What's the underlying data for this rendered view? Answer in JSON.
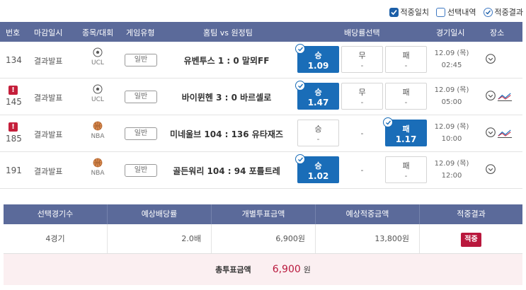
{
  "legend": [
    {
      "label": "적중일치",
      "state": "checked"
    },
    {
      "label": "선택내역",
      "state": "empty"
    },
    {
      "label": "적중결과",
      "state": "circle"
    }
  ],
  "columns": [
    "번호",
    "마감일시",
    "종목/대회",
    "게임유형",
    "홈팀 vs 원정팀",
    "배당률선택",
    "경기일시",
    "장소"
  ],
  "rows": [
    {
      "no": "134",
      "alert": false,
      "status": "결과발표",
      "sport_icon": "soccer-ball-icon",
      "league": "UCL",
      "type": "일반",
      "match": "유벤투스 1 : 0 말뫼FF",
      "odds": [
        {
          "label": "승",
          "value": "1.09",
          "selected": true
        },
        {
          "label": "무",
          "value": "-",
          "selected": false
        },
        {
          "label": "패",
          "value": "-",
          "selected": false
        }
      ],
      "date": "12.09 (목)",
      "time": "02:45",
      "chart": false
    },
    {
      "no": "145",
      "alert": true,
      "status": "결과발표",
      "sport_icon": "soccer-ball-icon",
      "league": "UCL",
      "type": "일반",
      "match": "바이뮌헨 3 : 0 바르셀로",
      "odds": [
        {
          "label": "승",
          "value": "1.47",
          "selected": true
        },
        {
          "label": "무",
          "value": "-",
          "selected": false
        },
        {
          "label": "패",
          "value": "-",
          "selected": false
        }
      ],
      "date": "12.09 (목)",
      "time": "05:00",
      "chart": true
    },
    {
      "no": "185",
      "alert": true,
      "status": "결과발표",
      "sport_icon": "basketball-icon",
      "league": "NBA",
      "type": "일반",
      "match": "미네울브 104 : 136 유타재즈",
      "odds": [
        {
          "label": "승",
          "value": "-",
          "selected": false
        },
        {
          "label": "-",
          "value": "",
          "selected": false,
          "dash": true
        },
        {
          "label": "패",
          "value": "1.17",
          "selected": true
        }
      ],
      "date": "12.09 (목)",
      "time": "10:00",
      "chart": true
    },
    {
      "no": "191",
      "alert": false,
      "status": "결과발표",
      "sport_icon": "basketball-icon",
      "league": "NBA",
      "type": "일반",
      "match": "골든워리 104 : 94 포틀트레",
      "odds": [
        {
          "label": "승",
          "value": "1.02",
          "selected": true
        },
        {
          "label": "-",
          "value": "",
          "selected": false,
          "dash": true
        },
        {
          "label": "패",
          "value": "-",
          "selected": false
        }
      ],
      "date": "12.09 (목)",
      "time": "12:00",
      "chart": false
    }
  ],
  "summary": {
    "headers": [
      "선택경기수",
      "예상배당률",
      "개별투표금액",
      "예상적중금액",
      "적중결과"
    ],
    "games": "4경기",
    "odds": "2.0배",
    "bet": "6,900원",
    "expected": "13,800원",
    "result": "적중",
    "total_label": "총투표금액",
    "total_value": "6,900",
    "total_unit": "원"
  },
  "colors": {
    "header": "#5b6a9a",
    "selected": "#1a6db8",
    "accent": "#b9183d"
  }
}
